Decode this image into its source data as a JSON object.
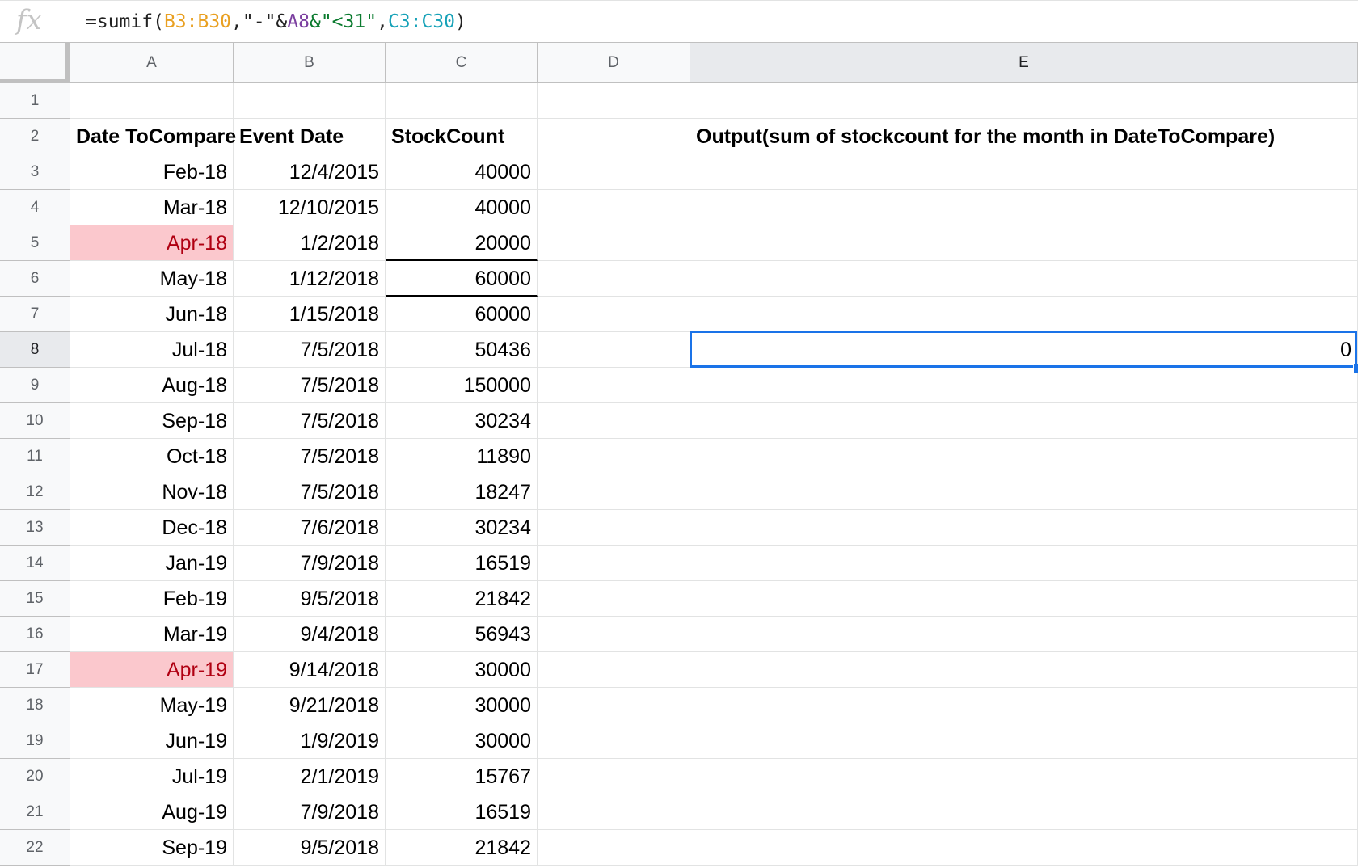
{
  "formula_bar": {
    "icon": "fx-icon",
    "tokens": [
      {
        "text": "=sumif(",
        "color": "default"
      },
      {
        "text": "B3:B30",
        "color": "orange"
      },
      {
        "text": ",",
        "color": "default"
      },
      {
        "text": "\"-\"&",
        "color": "default"
      },
      {
        "text": "A8",
        "color": "purple"
      },
      {
        "text": "&\"<31\"",
        "color": "green"
      },
      {
        "text": ",",
        "color": "default"
      },
      {
        "text": "C3:C30",
        "color": "teal"
      },
      {
        "text": ")",
        "color": "default"
      }
    ]
  },
  "columns": [
    "A",
    "B",
    "C",
    "D",
    "E"
  ],
  "selected_column": "E",
  "selected_row": "8",
  "rows": [
    "1",
    "2",
    "3",
    "4",
    "5",
    "6",
    "7",
    "8",
    "9",
    "10",
    "11",
    "12",
    "13",
    "14",
    "15",
    "16",
    "17",
    "18",
    "19",
    "20",
    "21",
    "22"
  ],
  "headers": {
    "A": "Date ToCompare",
    "B": "Event Date",
    "C": "StockCount",
    "E": "Output(sum of stockcount for the month in DateToCompare)"
  },
  "data_rows": [
    {
      "row": "3",
      "A": "Feb-18",
      "B": "12/4/2015",
      "C": "40000"
    },
    {
      "row": "4",
      "A": "Mar-18",
      "B": "12/10/2015",
      "C": "40000"
    },
    {
      "row": "5",
      "A": "Apr-18",
      "B": "1/2/2018",
      "C": "20000",
      "highlight_A": true
    },
    {
      "row": "6",
      "A": "May-18",
      "B": "1/12/2018",
      "C": "60000"
    },
    {
      "row": "7",
      "A": "Jun-18",
      "B": "1/15/2018",
      "C": "60000"
    },
    {
      "row": "8",
      "A": "Jul-18",
      "B": "7/5/2018",
      "C": "50436",
      "E": "0"
    },
    {
      "row": "9",
      "A": "Aug-18",
      "B": "7/5/2018",
      "C": "150000"
    },
    {
      "row": "10",
      "A": "Sep-18",
      "B": "7/5/2018",
      "C": "30234"
    },
    {
      "row": "11",
      "A": "Oct-18",
      "B": "7/5/2018",
      "C": "11890"
    },
    {
      "row": "12",
      "A": "Nov-18",
      "B": "7/5/2018",
      "C": "18247"
    },
    {
      "row": "13",
      "A": "Dec-18",
      "B": "7/6/2018",
      "C": "30234"
    },
    {
      "row": "14",
      "A": "Jan-19",
      "B": "7/9/2018",
      "C": "16519"
    },
    {
      "row": "15",
      "A": "Feb-19",
      "B": "9/5/2018",
      "C": "21842"
    },
    {
      "row": "16",
      "A": "Mar-19",
      "B": "9/4/2018",
      "C": "56943"
    },
    {
      "row": "17",
      "A": "Apr-19",
      "B": "9/14/2018",
      "C": "30000",
      "highlight_A": true
    },
    {
      "row": "18",
      "A": "May-19",
      "B": "9/21/2018",
      "C": "30000"
    },
    {
      "row": "19",
      "A": "Jun-19",
      "B": "1/9/2019",
      "C": "30000"
    },
    {
      "row": "20",
      "A": "Jul-19",
      "B": "2/1/2019",
      "C": "15767"
    },
    {
      "row": "21",
      "A": "Aug-19",
      "B": "7/9/2018",
      "C": "16519"
    },
    {
      "row": "22",
      "A": "Sep-19",
      "B": "9/5/2018",
      "C": "21842"
    }
  ],
  "colors": {
    "highlight_fill": "#fbc8cd",
    "highlight_text": "#b00012",
    "selection": "#1a73e8"
  }
}
